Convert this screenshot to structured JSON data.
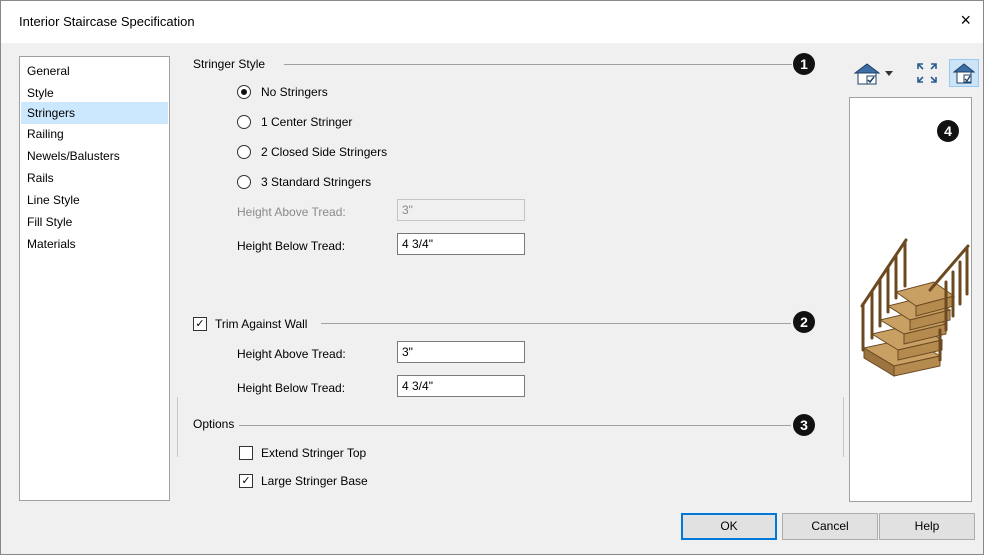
{
  "window": {
    "title": "Interior Staircase Specification",
    "close_glyph": "×"
  },
  "sidebar": {
    "items": [
      {
        "label": "General"
      },
      {
        "label": "Style"
      },
      {
        "label": "Stringers",
        "selected": true
      },
      {
        "label": "Railing"
      },
      {
        "label": "Newels/Balusters"
      },
      {
        "label": "Rails"
      },
      {
        "label": "Line Style"
      },
      {
        "label": "Fill Style"
      },
      {
        "label": "Materials"
      }
    ]
  },
  "stringer_style": {
    "title": "Stringer Style",
    "badge": "1",
    "options": [
      {
        "label": "No Stringers",
        "checked": true
      },
      {
        "label": "1 Center Stringer",
        "checked": false
      },
      {
        "label": "2 Closed Side Stringers",
        "checked": false
      },
      {
        "label": "3 Standard Stringers",
        "checked": false
      }
    ],
    "height_above": {
      "label": "Height Above Tread:",
      "value": "3\"",
      "disabled": true
    },
    "height_below": {
      "label": "Height Below Tread:",
      "value": "4 3/4\""
    }
  },
  "trim_against_wall": {
    "label": "Trim Against Wall",
    "checked": true,
    "badge": "2",
    "height_above": {
      "label": "Height Above Tread:",
      "value": "3\""
    },
    "height_below": {
      "label": "Height Below Tread:",
      "value": "4 3/4\""
    }
  },
  "options": {
    "title": "Options",
    "badge": "3",
    "extend_stringer_top": {
      "label": "Extend Stringer Top",
      "checked": false
    },
    "large_stringer_base": {
      "label": "Large Stringer Base",
      "checked": true
    }
  },
  "preview": {
    "badge": "4",
    "toolbar": [
      "camera-view-icon",
      "fit-view-icon",
      "preview-toggle-icon"
    ]
  },
  "buttons": {
    "ok": "OK",
    "cancel": "Cancel",
    "help": "Help"
  },
  "colors": {
    "selection": "#cce8ff",
    "default_button_border": "#0078d7",
    "wood": "#b58a4e"
  }
}
